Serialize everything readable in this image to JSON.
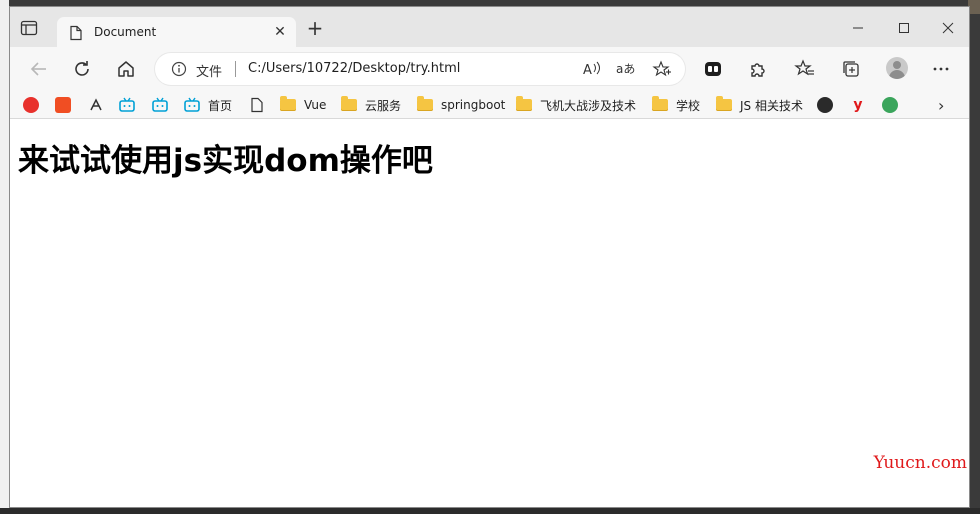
{
  "window": {
    "tab_title": "Document",
    "new_tab_symbol": "+",
    "tab_close_symbol": "✕"
  },
  "toolbar": {
    "scheme_label": "文件",
    "url": "C:/Users/10722/Desktop/try.html"
  },
  "bookmarks": {
    "items": [
      {
        "label": "首页"
      },
      {
        "label": "Vue"
      },
      {
        "label": "云服务"
      },
      {
        "label": "springboot"
      },
      {
        "label": "飞机大战涉及技术"
      },
      {
        "label": "学校"
      },
      {
        "label": "JS 相关技术"
      }
    ],
    "overflow_symbol": "›"
  },
  "page": {
    "heading": "来试试使用js实现dom操作吧"
  },
  "watermark": "Yuucn.com",
  "icons": [
    "sidebar-icon",
    "document-icon",
    "close-icon",
    "plus-icon",
    "minimize-icon",
    "maximize-icon",
    "window-close-icon",
    "back-icon",
    "refresh-icon",
    "home-icon",
    "info-icon",
    "read-aloud-icon",
    "translate-icon",
    "add-favorite-icon",
    "extension-icon",
    "puzzle-icon",
    "favorites-icon",
    "collections-icon",
    "profile-icon",
    "more-icon"
  ],
  "colors": {
    "accent_red": "#e0191b",
    "folder": "#f5c542",
    "bilibili": "#00a1d6"
  }
}
